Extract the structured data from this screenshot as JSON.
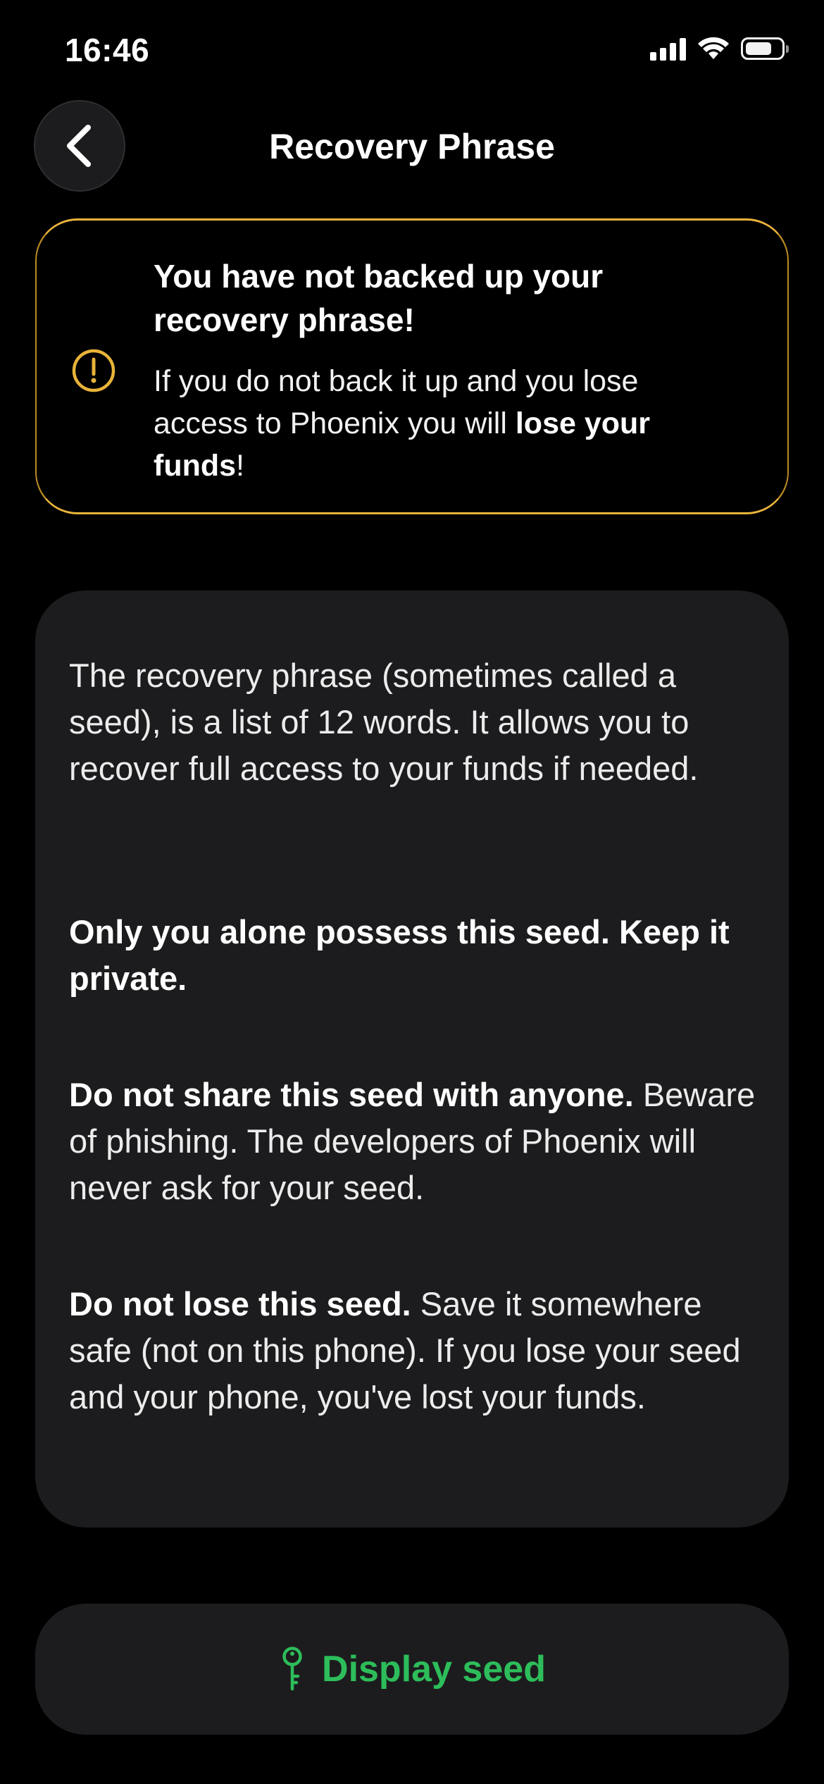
{
  "status_bar": {
    "time": "16:46",
    "icons": [
      "cellular-signal-icon",
      "wifi-icon",
      "battery-icon"
    ]
  },
  "header": {
    "back_icon": "chevron-left-icon",
    "title": "Recovery Phrase"
  },
  "warning": {
    "icon": "exclamation-circle-icon",
    "title": "You have not backed up your recovery phrase!",
    "body_prefix": "If you do not back it up and you lose access to Phoenix you will ",
    "body_bold": "lose your funds",
    "body_suffix": "!"
  },
  "info": {
    "p1": "The recovery phrase (sometimes called a seed), is a list of 12 words. It allows you to recover full access to your funds if needed.",
    "p2_bold": "Only you alone possess this seed. Keep it private.",
    "p3_bold": "Do not share this seed with anyone.",
    "p3_rest": " Beware of phishing. The developers of Phoenix will never ask for your seed.",
    "p4_bold": "Do not lose this seed.",
    "p4_rest": " Save it somewhere safe (not on this phone). If you lose your seed and your phone, you've lost your funds."
  },
  "action": {
    "icon": "key-icon",
    "label": "Display seed"
  },
  "colors": {
    "background": "#000000",
    "card": "#1c1c1e",
    "warning_accent": "#e8b33a",
    "action_green": "#2dbd5a"
  }
}
